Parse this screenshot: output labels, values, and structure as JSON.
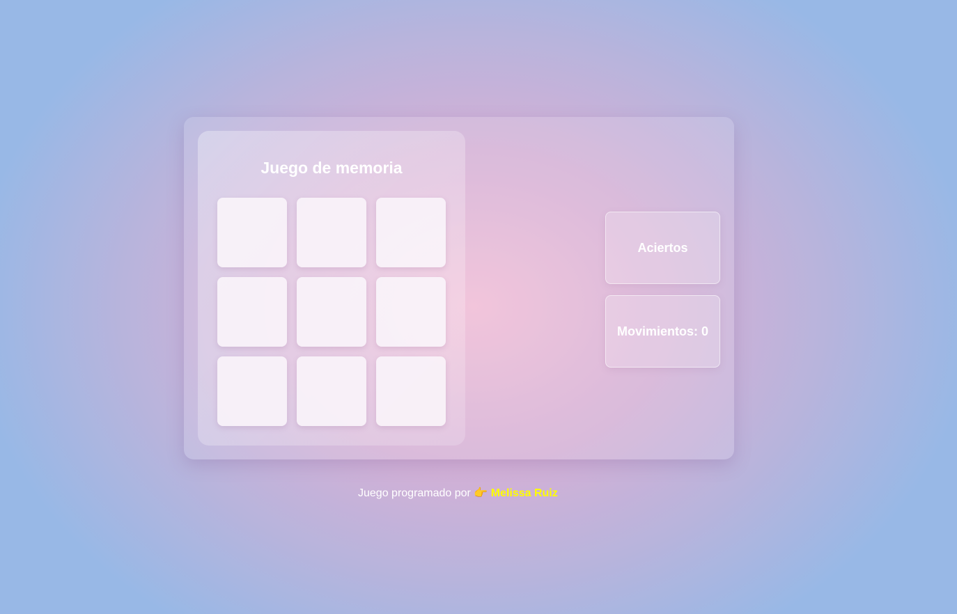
{
  "game": {
    "title": "Juego de memoria",
    "cards": [
      {},
      {},
      {},
      {},
      {},
      {},
      {},
      {},
      {}
    ]
  },
  "stats": {
    "hits_label": "Aciertos",
    "moves_label": "Movimientos: 0"
  },
  "footer": {
    "text": "Juego programado por",
    "icon": "pointing-right-hand",
    "emoji": "👉",
    "author": "Melissa Ruiz",
    "author_color": "#ffff00"
  }
}
